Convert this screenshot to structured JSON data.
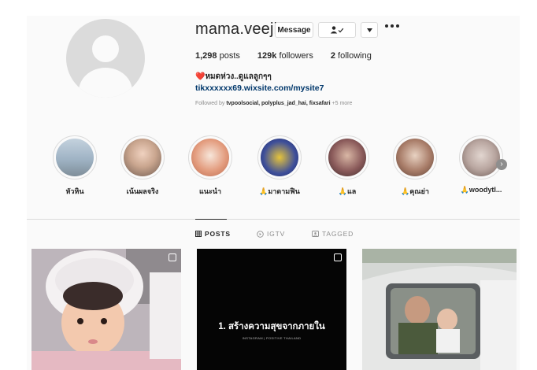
{
  "profile": {
    "username": "mama.veeji",
    "message_label": "Message",
    "follow_icon": "person-check-icon",
    "dropdown_icon": "caret-down-icon",
    "more_icon": "more-horizontal-icon",
    "stats": {
      "posts_count": "1,298",
      "posts_label": "posts",
      "followers_count": "129k",
      "followers_label": "followers",
      "following_count": "2",
      "following_label": "following"
    },
    "bio": "❤️หมดห่วง..ดูแลลูกๆๆ",
    "link": "tikxxxxxx69.wixsite.com/mysite7",
    "followed_by_prefix": "Followed by",
    "followed_by_names": "tvpoolsocial, polyplus_jad_hai, fixsafari",
    "followed_by_more": "+5 more"
  },
  "highlights": [
    {
      "label": "หัวหิน",
      "color": "#9fb3c4"
    },
    {
      "label": "เน้นผลจริง",
      "color": "#c9a58e"
    },
    {
      "label": "แนะนำ",
      "color": "#e39c7e"
    },
    {
      "label": "🙏มาดามฟิน",
      "color": "#3e4f9a"
    },
    {
      "label": "🙏แล",
      "color": "#8a5a5a"
    },
    {
      "label": "🙏คุณย่า",
      "color": "#a87c68"
    },
    {
      "label": "🙏woodytl...",
      "color": "#b9a6a0"
    }
  ],
  "tabs": {
    "posts": "POSTS",
    "igtv": "IGTV",
    "tagged": "TAGGED"
  },
  "posts": [
    {
      "type": "carousel"
    },
    {
      "type": "carousel",
      "text": "1. สร้างความสุขจากภายใน",
      "subtext": "INSTAGRAM | POSITIVE THAILAND"
    },
    {
      "type": "photo"
    }
  ]
}
